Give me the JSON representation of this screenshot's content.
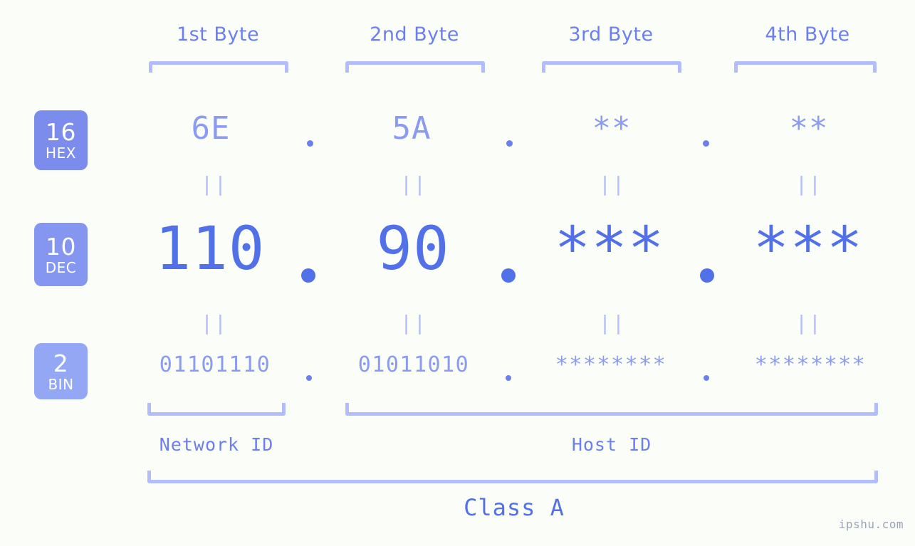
{
  "watermark": "ipshu.com",
  "headers": [
    {
      "label": "1st Byte"
    },
    {
      "label": "2nd Byte"
    },
    {
      "label": "3rd Byte"
    },
    {
      "label": "4th Byte"
    }
  ],
  "bases": [
    {
      "num": "16",
      "system": "HEX",
      "color": "#7b8ced"
    },
    {
      "num": "10",
      "system": "DEC",
      "color": "#8596f1"
    },
    {
      "num": "2",
      "system": "BIN",
      "color": "#93a7f5"
    }
  ],
  "rows": {
    "hex": {
      "base": "16",
      "system": "HEX",
      "values": [
        "6E",
        "5A",
        "**",
        "**"
      ]
    },
    "dec": {
      "base": "10",
      "system": "DEC",
      "values": [
        "110",
        "90",
        "***",
        "***"
      ]
    },
    "bin": {
      "base": "2",
      "system": "BIN",
      "values": [
        "01101110",
        "01011010",
        "********",
        "********"
      ]
    }
  },
  "separators": {
    "dot": ".",
    "equality": "||"
  },
  "segments": {
    "network_id": "Network ID",
    "host_id": "Host ID"
  },
  "class_label": "Class A",
  "colors": {
    "background": "#fbfdf8",
    "primary": "#5271e8",
    "secondary": "#6c7ff0",
    "muted": "#8b9bf0",
    "bracket": "#b3bdfb",
    "watermark": "#9aa3b8"
  },
  "chart_data": {
    "type": "table",
    "title": "IPv4 address byte decomposition",
    "columns": [
      "1st Byte",
      "2nd Byte",
      "3rd Byte",
      "4th Byte"
    ],
    "rows": [
      {
        "base": 16,
        "system": "HEX",
        "values": [
          "6E",
          "5A",
          "**",
          "**"
        ]
      },
      {
        "base": 10,
        "system": "DEC",
        "values": [
          "110",
          "90",
          "***",
          "***"
        ]
      },
      {
        "base": 2,
        "system": "BIN",
        "values": [
          "01101110",
          "01011010",
          "********",
          "********"
        ]
      }
    ],
    "network_id_bytes": 1,
    "host_id_bytes": 3,
    "address_class": "Class A"
  }
}
